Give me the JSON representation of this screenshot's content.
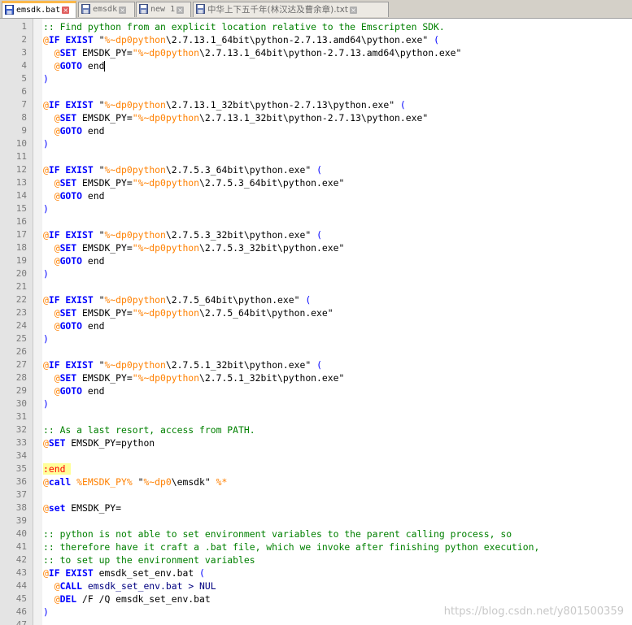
{
  "tabs": [
    {
      "label": "emsdk.bat",
      "active": true,
      "icon": "save-disk-icon"
    },
    {
      "label": "emsdk",
      "active": false,
      "icon": "save-disk-icon"
    },
    {
      "label": "new 1",
      "active": false,
      "icon": "save-disk-icon"
    },
    {
      "label": "中华上下五千年(林汉达及曹余章).txt",
      "active": false,
      "icon": "save-disk-icon"
    }
  ],
  "close_glyph": "×",
  "watermark": "https://blog.csdn.net/y801500359",
  "colors": {
    "active_tab_accent": "#fbb84a",
    "comment": "#008000",
    "keyword": "#0000ff",
    "at_sign": "#ff8000",
    "label": "#ff0000"
  },
  "editor": {
    "lines": [
      [
        [
          "cm",
          ":: Find python from an explicit location relative to the Emscripten SDK."
        ]
      ],
      [
        [
          "at",
          "@"
        ],
        [
          "kw",
          "IF EXIST"
        ],
        [
          "plain",
          " \""
        ],
        [
          "var",
          "%~dp0python"
        ],
        [
          "plain",
          "\\2.7.13.1_64bit\\python-2.7.13.amd64\\python.exe\" "
        ],
        [
          "paren",
          "("
        ]
      ],
      [
        [
          "plain",
          "  "
        ],
        [
          "at",
          "@"
        ],
        [
          "kw",
          "SET"
        ],
        [
          "plain",
          " EMSDK_PY="
        ],
        [
          "var",
          "\"%~dp0python"
        ],
        [
          "plain",
          "\\2.7.13.1_64bit\\python-2.7.13.amd64\\python.exe\""
        ]
      ],
      [
        [
          "plain",
          "  "
        ],
        [
          "at",
          "@"
        ],
        [
          "kw",
          "GOTO"
        ],
        [
          "plain",
          " end"
        ]
      ],
      [
        [
          "paren",
          ")"
        ]
      ],
      [],
      [
        [
          "at",
          "@"
        ],
        [
          "kw",
          "IF EXIST"
        ],
        [
          "plain",
          " \""
        ],
        [
          "var",
          "%~dp0python"
        ],
        [
          "plain",
          "\\2.7.13.1_32bit\\python-2.7.13\\python.exe\" "
        ],
        [
          "paren",
          "("
        ]
      ],
      [
        [
          "plain",
          "  "
        ],
        [
          "at",
          "@"
        ],
        [
          "kw",
          "SET"
        ],
        [
          "plain",
          " EMSDK_PY="
        ],
        [
          "var",
          "\"%~dp0python"
        ],
        [
          "plain",
          "\\2.7.13.1_32bit\\python-2.7.13\\python.exe\""
        ]
      ],
      [
        [
          "plain",
          "  "
        ],
        [
          "at",
          "@"
        ],
        [
          "kw",
          "GOTO"
        ],
        [
          "plain",
          " end"
        ]
      ],
      [
        [
          "paren",
          ")"
        ]
      ],
      [],
      [
        [
          "at",
          "@"
        ],
        [
          "kw",
          "IF EXIST"
        ],
        [
          "plain",
          " \""
        ],
        [
          "var",
          "%~dp0python"
        ],
        [
          "plain",
          "\\2.7.5.3_64bit\\python.exe\" "
        ],
        [
          "paren",
          "("
        ]
      ],
      [
        [
          "plain",
          "  "
        ],
        [
          "at",
          "@"
        ],
        [
          "kw",
          "SET"
        ],
        [
          "plain",
          " EMSDK_PY="
        ],
        [
          "var",
          "\"%~dp0python"
        ],
        [
          "plain",
          "\\2.7.5.3_64bit\\python.exe\""
        ]
      ],
      [
        [
          "plain",
          "  "
        ],
        [
          "at",
          "@"
        ],
        [
          "kw",
          "GOTO"
        ],
        [
          "plain",
          " end"
        ]
      ],
      [
        [
          "paren",
          ")"
        ]
      ],
      [],
      [
        [
          "at",
          "@"
        ],
        [
          "kw",
          "IF EXIST"
        ],
        [
          "plain",
          " \""
        ],
        [
          "var",
          "%~dp0python"
        ],
        [
          "plain",
          "\\2.7.5.3_32bit\\python.exe\" "
        ],
        [
          "paren",
          "("
        ]
      ],
      [
        [
          "plain",
          "  "
        ],
        [
          "at",
          "@"
        ],
        [
          "kw",
          "SET"
        ],
        [
          "plain",
          " EMSDK_PY="
        ],
        [
          "var",
          "\"%~dp0python"
        ],
        [
          "plain",
          "\\2.7.5.3_32bit\\python.exe\""
        ]
      ],
      [
        [
          "plain",
          "  "
        ],
        [
          "at",
          "@"
        ],
        [
          "kw",
          "GOTO"
        ],
        [
          "plain",
          " end"
        ]
      ],
      [
        [
          "paren",
          ")"
        ]
      ],
      [],
      [
        [
          "at",
          "@"
        ],
        [
          "kw",
          "IF EXIST"
        ],
        [
          "plain",
          " \""
        ],
        [
          "var",
          "%~dp0python"
        ],
        [
          "plain",
          "\\2.7.5_64bit\\python.exe\" "
        ],
        [
          "paren",
          "("
        ]
      ],
      [
        [
          "plain",
          "  "
        ],
        [
          "at",
          "@"
        ],
        [
          "kw",
          "SET"
        ],
        [
          "plain",
          " EMSDK_PY="
        ],
        [
          "var",
          "\"%~dp0python"
        ],
        [
          "plain",
          "\\2.7.5_64bit\\python.exe\""
        ]
      ],
      [
        [
          "plain",
          "  "
        ],
        [
          "at",
          "@"
        ],
        [
          "kw",
          "GOTO"
        ],
        [
          "plain",
          " end"
        ]
      ],
      [
        [
          "paren",
          ")"
        ]
      ],
      [],
      [
        [
          "at",
          "@"
        ],
        [
          "kw",
          "IF EXIST"
        ],
        [
          "plain",
          " \""
        ],
        [
          "var",
          "%~dp0python"
        ],
        [
          "plain",
          "\\2.7.5.1_32bit\\python.exe\" "
        ],
        [
          "paren",
          "("
        ]
      ],
      [
        [
          "plain",
          "  "
        ],
        [
          "at",
          "@"
        ],
        [
          "kw",
          "SET"
        ],
        [
          "plain",
          " EMSDK_PY="
        ],
        [
          "var",
          "\"%~dp0python"
        ],
        [
          "plain",
          "\\2.7.5.1_32bit\\python.exe\""
        ]
      ],
      [
        [
          "plain",
          "  "
        ],
        [
          "at",
          "@"
        ],
        [
          "kw",
          "GOTO"
        ],
        [
          "plain",
          " end"
        ]
      ],
      [
        [
          "paren",
          ")"
        ]
      ],
      [],
      [
        [
          "cm",
          ":: As a last resort, access from PATH."
        ]
      ],
      [
        [
          "at",
          "@"
        ],
        [
          "kw",
          "SET"
        ],
        [
          "plain",
          " EMSDK_PY=python"
        ]
      ],
      [],
      [
        [
          "lbl",
          ":end "
        ]
      ],
      [
        [
          "at",
          "@"
        ],
        [
          "kw",
          "call"
        ],
        [
          "plain",
          " "
        ],
        [
          "var",
          "%EMSDK_PY%"
        ],
        [
          "plain",
          " \""
        ],
        [
          "var",
          "%~dp0"
        ],
        [
          "plain",
          "\\emsdk\" "
        ],
        [
          "var",
          "%*"
        ]
      ],
      [],
      [
        [
          "at",
          "@"
        ],
        [
          "kw",
          "set"
        ],
        [
          "plain",
          " EMSDK_PY="
        ]
      ],
      [],
      [
        [
          "cm",
          ":: python is not able to set environment variables to the parent calling process, so"
        ]
      ],
      [
        [
          "cm",
          ":: therefore have it craft a .bat file, which we invoke after finishing python execution,"
        ]
      ],
      [
        [
          "cm",
          ":: to set up the environment variables"
        ]
      ],
      [
        [
          "at",
          "@"
        ],
        [
          "kw",
          "IF EXIST"
        ],
        [
          "plain",
          " emsdk_set_env.bat "
        ],
        [
          "paren",
          "("
        ]
      ],
      [
        [
          "plain",
          "  "
        ],
        [
          "at",
          "@"
        ],
        [
          "kw",
          "CALL"
        ],
        [
          "plain",
          " "
        ],
        [
          "op",
          "emsdk_set_env.bat > NUL"
        ]
      ],
      [
        [
          "plain",
          "  "
        ],
        [
          "at",
          "@"
        ],
        [
          "kw",
          "DEL"
        ],
        [
          "plain",
          " /F /Q emsdk_set_env.bat"
        ]
      ],
      [
        [
          "paren",
          ")"
        ]
      ],
      []
    ],
    "caret_line": 4
  }
}
